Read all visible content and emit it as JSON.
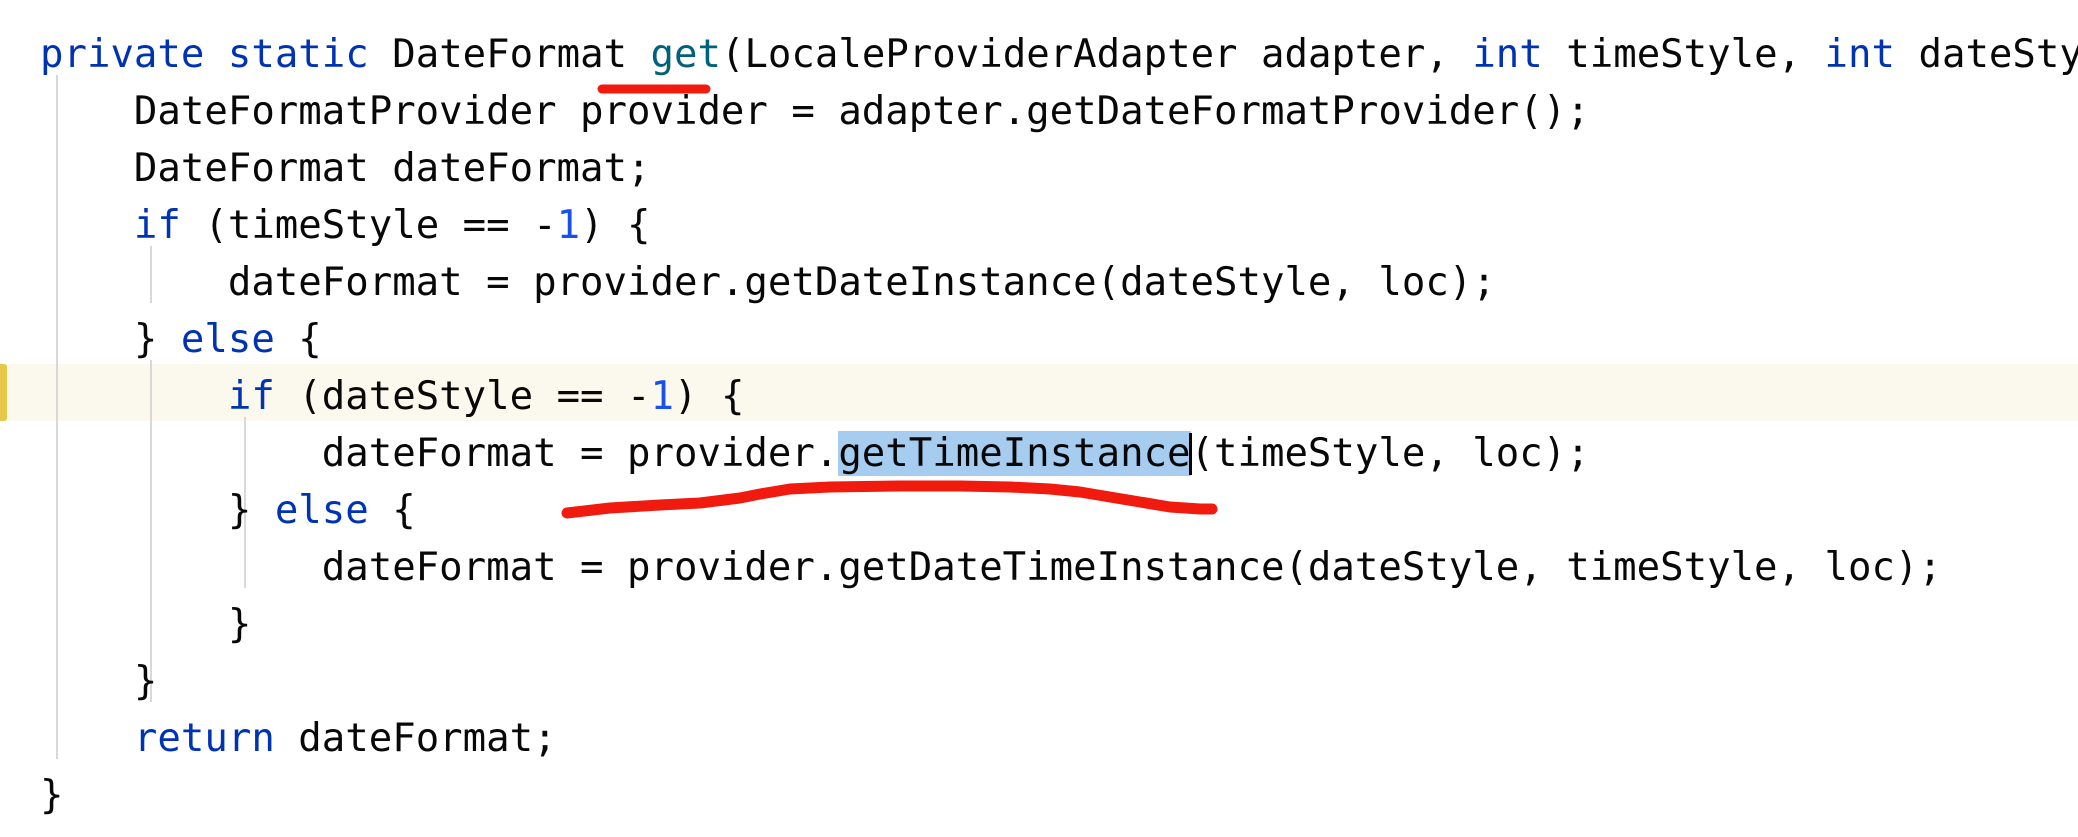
{
  "editor": {
    "language": "java",
    "background_color": "#ffffff",
    "font_size_px": 39,
    "line_height_px": 57,
    "theme": "light",
    "current_line_highlight_color": "#fbf8ed",
    "current_line_marker_color": "#e8c84a",
    "selection_color": "#a6cdf0",
    "indent_guide_color": "#d8d8d8",
    "keyword_color": "#0033b3",
    "number_color": "#1750eb",
    "method_color": "#00627a",
    "text_color": "#080808",
    "annotation_color": "#f01a0f",
    "caret_visible": true,
    "current_line_index": 6,
    "selected_text": "getTimeInstance"
  },
  "code": {
    "lines": [
      {
        "indent": 0,
        "tokens": [
          {
            "t": "private",
            "c": "kw"
          },
          {
            "t": " ",
            "c": "plain"
          },
          {
            "t": "static",
            "c": "kw"
          },
          {
            "t": " DateFormat ",
            "c": "plain"
          },
          {
            "t": "get",
            "c": "method"
          },
          {
            "t": "(LocaleProviderAdapter adapter, ",
            "c": "plain"
          },
          {
            "t": "int",
            "c": "kw"
          },
          {
            "t": " timeStyle, ",
            "c": "plain"
          },
          {
            "t": "int",
            "c": "kw"
          },
          {
            "t": " dateStyle, L",
            "c": "plain"
          }
        ],
        "plain": "private static DateFormat get(LocaleProviderAdapter adapter, int timeStyle, int dateStyle, L"
      },
      {
        "indent": 1,
        "tokens": [
          {
            "t": "DateFormatProvider provider = adapter.getDateFormatProvider();",
            "c": "plain"
          }
        ],
        "plain": "    DateFormatProvider provider = adapter.getDateFormatProvider();"
      },
      {
        "indent": 1,
        "tokens": [
          {
            "t": "DateFormat dateFormat;",
            "c": "plain"
          }
        ],
        "plain": "    DateFormat dateFormat;"
      },
      {
        "indent": 1,
        "tokens": [
          {
            "t": "if",
            "c": "kw"
          },
          {
            "t": " (timeStyle == -",
            "c": "plain"
          },
          {
            "t": "1",
            "c": "num"
          },
          {
            "t": ") {",
            "c": "plain"
          }
        ],
        "plain": "    if (timeStyle == -1) {"
      },
      {
        "indent": 2,
        "tokens": [
          {
            "t": "dateFormat = provider.getDateInstance(dateStyle, loc);",
            "c": "plain"
          }
        ],
        "plain": "        dateFormat = provider.getDateInstance(dateStyle, loc);"
      },
      {
        "indent": 1,
        "tokens": [
          {
            "t": "} ",
            "c": "plain"
          },
          {
            "t": "else",
            "c": "kw"
          },
          {
            "t": " {",
            "c": "plain"
          }
        ],
        "plain": "    } else {"
      },
      {
        "indent": 2,
        "tokens": [
          {
            "t": "if",
            "c": "kw"
          },
          {
            "t": " (dateStyle == -",
            "c": "plain"
          },
          {
            "t": "1",
            "c": "num"
          },
          {
            "t": ") {",
            "c": "plain"
          }
        ],
        "plain": "        if (dateStyle == -1) {"
      },
      {
        "indent": 3,
        "tokens": [
          {
            "t": "dateFormat = provider.",
            "c": "plain"
          },
          {
            "t": "getTimeInstance",
            "c": "plain",
            "sel": true
          },
          {
            "t": "CARET",
            "c": "caret"
          },
          {
            "t": "(timeStyle, loc);",
            "c": "plain"
          }
        ],
        "plain": "            dateFormat = provider.getTimeInstance(timeStyle, loc);"
      },
      {
        "indent": 2,
        "tokens": [
          {
            "t": "} ",
            "c": "plain"
          },
          {
            "t": "else",
            "c": "kw"
          },
          {
            "t": " {",
            "c": "plain"
          }
        ],
        "plain": "        } else {"
      },
      {
        "indent": 3,
        "tokens": [
          {
            "t": "dateFormat = provider.getDateTimeInstance(dateStyle, timeStyle, loc);",
            "c": "plain"
          }
        ],
        "plain": "            dateFormat = provider.getDateTimeInstance(dateStyle, timeStyle, loc);"
      },
      {
        "indent": 2,
        "tokens": [
          {
            "t": "}",
            "c": "plain"
          }
        ],
        "plain": "        }"
      },
      {
        "indent": 1,
        "tokens": [
          {
            "t": "}",
            "c": "plain"
          }
        ],
        "plain": "    }"
      },
      {
        "indent": 1,
        "tokens": [
          {
            "t": "return",
            "c": "kw"
          },
          {
            "t": " dateFormat;",
            "c": "plain"
          }
        ],
        "plain": "    return dateFormat;"
      },
      {
        "indent": 0,
        "tokens": [
          {
            "t": "}",
            "c": "plain"
          }
        ],
        "plain": "}"
      }
    ]
  },
  "annotations": [
    {
      "kind": "red-underline",
      "target": "get",
      "label": "red underline under method name get"
    },
    {
      "kind": "red-arc-underline",
      "target": "provider.getTimeInstance",
      "label": "hand drawn red arc underlining provider.getTimeInstance"
    }
  ]
}
